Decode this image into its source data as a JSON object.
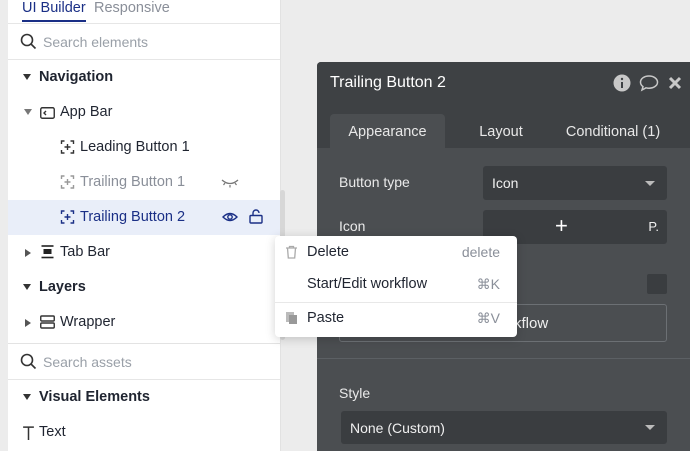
{
  "left_panel": {
    "tabs": {
      "active": "UI Builder",
      "inactive": "Responsive"
    },
    "search_elements_placeholder": "Search elements",
    "tree": {
      "navigation": "Navigation",
      "app_bar": "App Bar",
      "leading_button_1": "Leading Button 1",
      "trailing_button_1": "Trailing Button 1",
      "trailing_button_2": "Trailing Button 2",
      "tab_bar": "Tab Bar",
      "layers": "Layers",
      "wrapper": "Wrapper"
    },
    "search_assets_placeholder": "Search assets",
    "visual_elements": "Visual Elements",
    "text_item": "Text"
  },
  "property_editor": {
    "title": "Trailing Button 2",
    "tabs": [
      "Appearance",
      "Layout",
      "Conditional (1)"
    ],
    "button_type_label": "Button type",
    "button_type_value": "Icon",
    "icon_label": "Icon",
    "icon_value": "+",
    "icon_suffix": "P.",
    "workflow_button_partial": "kflow",
    "style_label": "Style",
    "style_value": "None (Custom)"
  },
  "context_menu": {
    "items": [
      {
        "label": "Delete",
        "shortcut": "delete"
      },
      {
        "label": "Start/Edit workflow",
        "shortcut": "⌘K"
      },
      {
        "label": "Paste",
        "shortcut": "⌘V"
      }
    ]
  },
  "colors": {
    "accent": "#1a2f86",
    "selected_row": "#e9eef9",
    "dark_panel": "#4b4e51",
    "dark_header": "#3e4144"
  }
}
